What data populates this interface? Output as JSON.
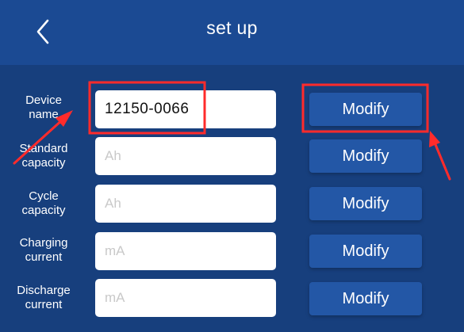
{
  "header": {
    "title": "set up",
    "back_icon": "chevron-left-icon"
  },
  "colors": {
    "header_bg": "#1b4a93",
    "content_bg": "#173f7d",
    "button_bg": "#2357a6",
    "annotation": "#ff2b2b"
  },
  "rows": [
    {
      "label": "Device\nname",
      "value": "12150-0066",
      "placeholder": "",
      "button": "Modify"
    },
    {
      "label": "Standard\ncapacity",
      "value": "",
      "placeholder": "Ah",
      "button": "Modify"
    },
    {
      "label": "Cycle\ncapacity",
      "value": "",
      "placeholder": "Ah",
      "button": "Modify"
    },
    {
      "label": "Charging\ncurrent",
      "value": "",
      "placeholder": "mA",
      "button": "Modify"
    },
    {
      "label": "Discharge\ncurrent",
      "value": "",
      "placeholder": "mA",
      "button": "Modify"
    }
  ]
}
